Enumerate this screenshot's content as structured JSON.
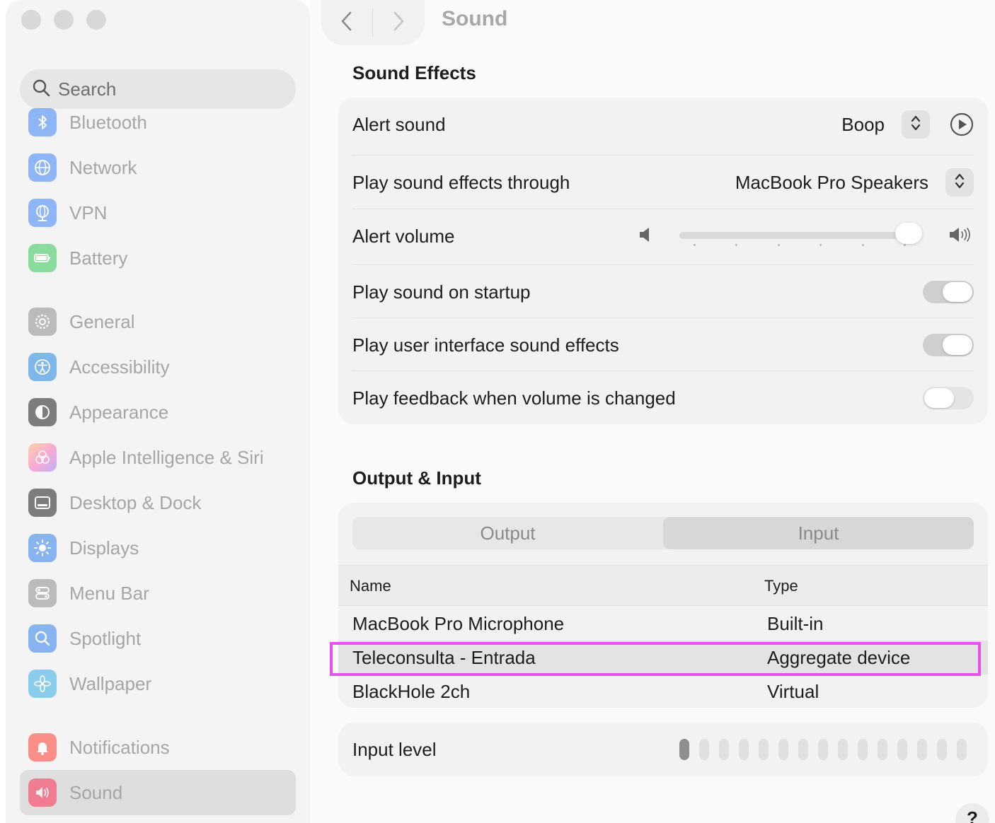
{
  "window": {
    "title": "Sound"
  },
  "search": {
    "placeholder": "Search"
  },
  "sidebar": {
    "items": [
      {
        "label": "Bluetooth",
        "icon": "bluetooth-icon",
        "color": "#3b82f6"
      },
      {
        "label": "Network",
        "icon": "globe-icon",
        "color": "#3b82f6"
      },
      {
        "label": "VPN",
        "icon": "vpn-globe-icon",
        "color": "#3b82f6"
      },
      {
        "label": "Battery",
        "icon": "battery-icon",
        "color": "#34c759"
      },
      {
        "label": "General",
        "icon": "gear-icon",
        "color": "#8e8e93"
      },
      {
        "label": "Accessibility",
        "icon": "accessibility-icon",
        "color": "#1e88e5"
      },
      {
        "label": "Appearance",
        "icon": "appearance-icon",
        "color": "#1c1c1e"
      },
      {
        "label": "Apple Intelligence & Siri",
        "icon": "siri-icon",
        "color": "#ff6fb5"
      },
      {
        "label": "Desktop & Dock",
        "icon": "dock-icon",
        "color": "#1c1c1e"
      },
      {
        "label": "Displays",
        "icon": "sun-icon",
        "color": "#2f80ed"
      },
      {
        "label": "Menu Bar",
        "icon": "menubar-icon",
        "color": "#8e8e93"
      },
      {
        "label": "Spotlight",
        "icon": "magnifier-icon",
        "color": "#2f80ed"
      },
      {
        "label": "Wallpaper",
        "icon": "flower-icon",
        "color": "#32ade6"
      },
      {
        "label": "Notifications",
        "icon": "bell-icon",
        "color": "#ff3b30"
      },
      {
        "label": "Sound",
        "icon": "speaker-icon",
        "color": "#ff2d55"
      }
    ],
    "selected": "Sound"
  },
  "sound_effects": {
    "heading": "Sound Effects",
    "alert_sound": {
      "label": "Alert sound",
      "value": "Boop"
    },
    "play_through": {
      "label": "Play sound effects through",
      "value": "MacBook Pro Speakers"
    },
    "alert_volume": {
      "label": "Alert volume",
      "level": 0.97
    },
    "startup": {
      "label": "Play sound on startup",
      "on": true
    },
    "ui_effects": {
      "label": "Play user interface sound effects",
      "on": true
    },
    "feedback": {
      "label": "Play feedback when volume is changed",
      "on": false
    }
  },
  "output_input": {
    "heading": "Output & Input",
    "tabs": [
      "Output",
      "Input"
    ],
    "active_tab": "Input",
    "columns": [
      "Name",
      "Type"
    ],
    "devices": [
      {
        "name": "MacBook Pro Microphone",
        "type": "Built-in"
      },
      {
        "name": "Teleconsulta - Entrada",
        "type": "Aggregate device"
      },
      {
        "name": "BlackHole 2ch",
        "type": "Virtual"
      }
    ],
    "selected_device": "Teleconsulta - Entrada",
    "highlight_color": "#ea4ff0"
  },
  "input_level": {
    "label": "Input level",
    "segments": 15,
    "active": 1
  },
  "help": {
    "label": "?"
  }
}
